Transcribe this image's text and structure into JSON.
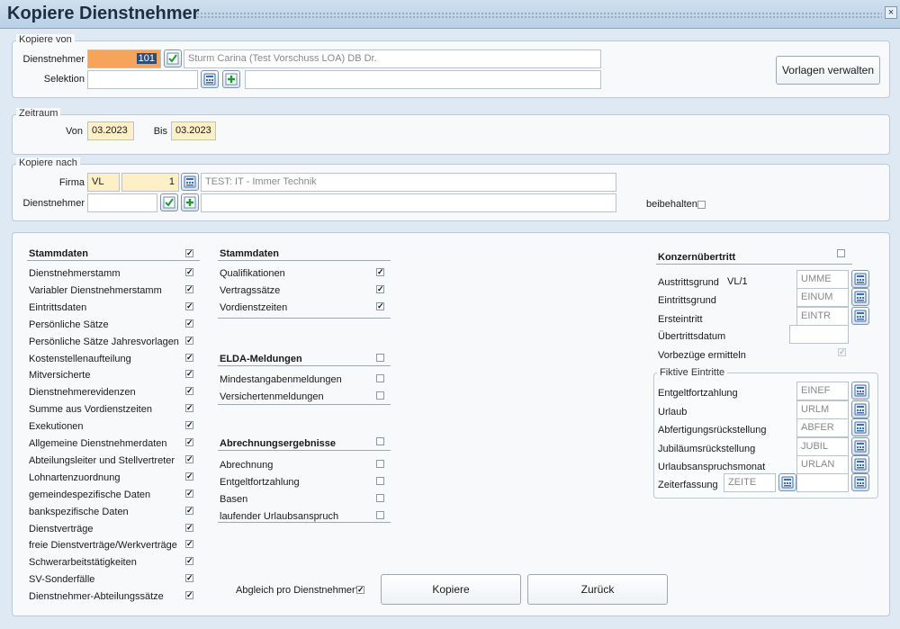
{
  "window": {
    "title": "Kopiere Dienstnehmer",
    "close_glyph": "×"
  },
  "kopiere_von": {
    "legend": "Kopiere von",
    "dienstnehmer_label": "Dienstnehmer",
    "dienstnehmer_id": "101",
    "dienstnehmer_name": "Sturm Carina (Test Vorschuss LOA) DB Dr.",
    "selektion_label": "Selektion",
    "selektion_value": "",
    "selektion_text": "",
    "vorlagen_button": "Vorlagen verwalten"
  },
  "zeitraum": {
    "legend": "Zeitraum",
    "von_label": "Von",
    "von_value": "03.2023",
    "bis_label": "Bis",
    "bis_value": "03.2023"
  },
  "kopiere_nach": {
    "legend": "Kopiere nach",
    "firma_label": "Firma",
    "firma_code": "VL",
    "firma_number": "1",
    "firma_name": "TEST: IT - Immer Technik",
    "dienstnehmer_label": "Dienstnehmer",
    "dienstnehmer_value": "",
    "dienstnehmer_name": "",
    "beibehalten_label": "beibehalten",
    "beibehalten_checked": false
  },
  "stammdaten_left": {
    "header": "Stammdaten",
    "header_checked": true,
    "items": [
      {
        "label": "Dienstnehmerstamm",
        "checked": true
      },
      {
        "label": "Variabler Dienstnehmerstamm",
        "checked": true
      },
      {
        "label": "Eintrittsdaten",
        "checked": true
      },
      {
        "label": "Persönliche Sätze",
        "checked": true
      },
      {
        "label": "Persönliche Sätze Jahresvorlagen",
        "checked": true
      },
      {
        "label": "Kostenstellenaufteilung",
        "checked": true
      },
      {
        "label": "Mitversicherte",
        "checked": true
      },
      {
        "label": "Dienstnehmerevidenzen",
        "checked": true
      },
      {
        "label": "Summe aus Vordienstzeiten",
        "checked": true
      },
      {
        "label": "Exekutionen",
        "checked": true
      },
      {
        "label": "Allgemeine Dienstnehmerdaten",
        "checked": true
      },
      {
        "label": "Abteilungsleiter und Stellvertreter",
        "checked": true
      },
      {
        "label": "Lohnartenzuordnung",
        "checked": true
      },
      {
        "label": "gemeindespezifische Daten",
        "checked": true
      },
      {
        "label": "bankspezifische Daten",
        "checked": true
      },
      {
        "label": "Dienstverträge",
        "checked": true
      },
      {
        "label": "freie Dienstverträge/Werkverträge",
        "checked": true
      },
      {
        "label": "Schwerarbeitstätigkeiten",
        "checked": true
      },
      {
        "label": "SV-Sonderfälle",
        "checked": true
      },
      {
        "label": "Dienstnehmer-Abteilungssätze",
        "checked": true
      }
    ]
  },
  "stammdaten_mid": {
    "header": "Stammdaten",
    "items": [
      {
        "label": "Qualifikationen",
        "checked": true
      },
      {
        "label": "Vertragssätze",
        "checked": true
      },
      {
        "label": "Vordienstzeiten",
        "checked": true
      }
    ]
  },
  "elda": {
    "header": "ELDA-Meldungen",
    "header_checked": false,
    "items": [
      {
        "label": "Mindestangabenmeldungen",
        "checked": false
      },
      {
        "label": "Versichertenmeldungen",
        "checked": false
      }
    ]
  },
  "abrechnung": {
    "header": "Abrechnungsergebnisse",
    "header_checked": false,
    "items": [
      {
        "label": "Abrechnung",
        "checked": false
      },
      {
        "label": "Entgeltfortzahlung",
        "checked": false
      },
      {
        "label": "Basen",
        "checked": false
      },
      {
        "label": "laufender Urlaubsanspruch",
        "checked": false
      }
    ]
  },
  "konzern": {
    "header": "Konzernübertritt",
    "header_checked": false,
    "austrittsgrund_label": "Austrittsgrund",
    "austrittsgrund_code": "VL/1",
    "austrittsgrund_value": "UMME",
    "eintrittsgrund_label": "Eintrittsgrund",
    "eintrittsgrund_value": "EINUM",
    "ersteintritt_label": "Ersteintritt",
    "ersteintritt_value": "EINTR",
    "uebertrittsdatum_label": "Übertrittsdatum",
    "uebertrittsdatum_value": "",
    "vorbezuege_label": "Vorbezüge ermitteln",
    "vorbezuege_checked": true
  },
  "fiktive": {
    "legend": "Fiktive Eintritte",
    "rows": [
      {
        "label": "Entgeltfortzahlung",
        "value": "EINEF"
      },
      {
        "label": "Urlaub",
        "value": "URLM"
      },
      {
        "label": "Abfertigungsrückstellung",
        "value": "ABFER"
      },
      {
        "label": "Jubiläumsrückstellung",
        "value": "JUBIL"
      },
      {
        "label": "Urlaubsanspruchsmonat",
        "value": "URLAN"
      }
    ],
    "zeiterfassung_label": "Zeiterfassung",
    "zeiterfassung_value": "ZEITE",
    "zeiterfassung_value2": ""
  },
  "footer": {
    "abgleich_label": "Abgleich pro Dienstnehmer?",
    "abgleich_checked": true,
    "kopiere_button": "Kopiere",
    "zurueck_button": "Zurück"
  },
  "icons": {
    "lookup": "calculator-lookup-icon",
    "confirm": "green-check-icon",
    "add": "green-plus-icon"
  }
}
